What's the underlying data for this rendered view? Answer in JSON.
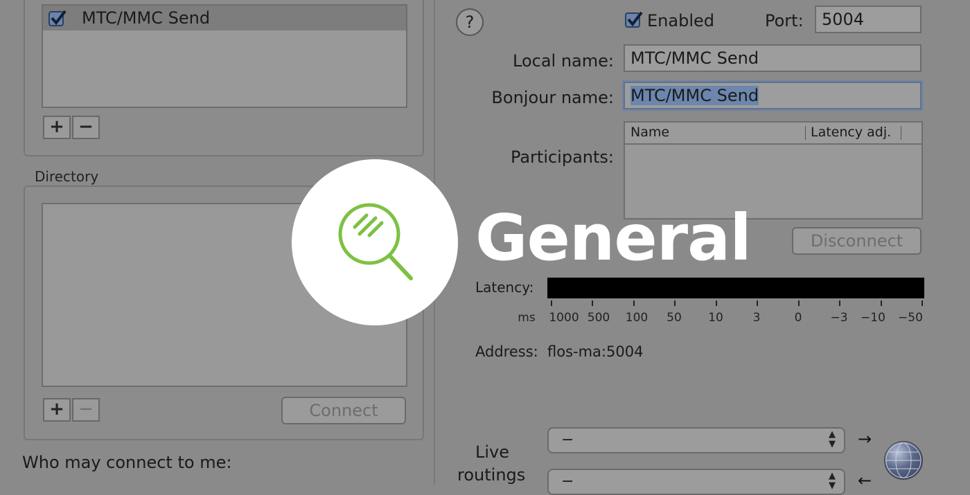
{
  "sessions": {
    "items": [
      {
        "label": "MTC/MMC Send",
        "checked": true
      }
    ],
    "add_label": "+",
    "remove_label": "−"
  },
  "directory": {
    "label": "Directory",
    "add_label": "+",
    "remove_label": "−",
    "connect_label": "Connect"
  },
  "who_may_connect_label": "Who may connect to me:",
  "session_settings": {
    "help_label": "?",
    "enabled_label": "Enabled",
    "enabled_checked": true,
    "port_label": "Port:",
    "port_value": "5004",
    "local_name_label": "Local name:",
    "local_name_value": "MTC/MMC Send",
    "bonjour_name_label": "Bonjour name:",
    "bonjour_name_value": "MTC/MMC Send",
    "participants_label": "Participants:",
    "participants_columns": [
      "Name",
      "Latency adj."
    ],
    "disconnect_label": "Disconnect",
    "latency_label": "Latency:",
    "latency_unit": "ms",
    "latency_ticks": [
      "1000",
      "500",
      "100",
      "50",
      "10",
      "3",
      "0",
      "−3",
      "−10",
      "−50"
    ],
    "address_label": "Address:",
    "address_value": "flos-ma:5004",
    "live_routings_label_1": "Live",
    "live_routings_label_2": "routings",
    "live_routing_in_value": "−",
    "live_routing_out_value": "−"
  },
  "overlay": {
    "title": "General",
    "accent_color": "#7dc142",
    "icon": "magnifier-icon"
  }
}
